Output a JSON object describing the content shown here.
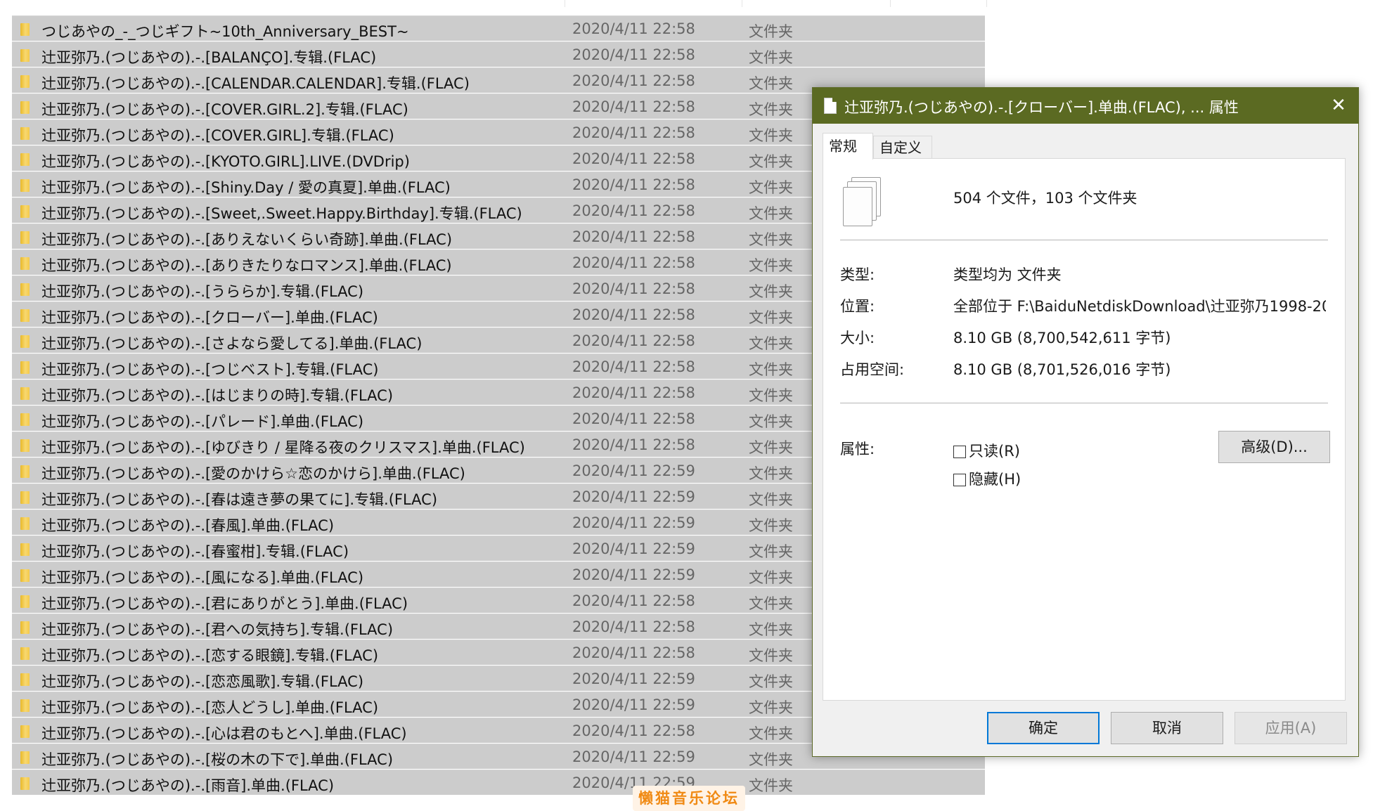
{
  "explorer": {
    "rows": [
      {
        "name": "つじあやの_-_つじギフト~10th_Anniversary_BEST~",
        "date": "2020/4/11 22:58",
        "type": "文件夹"
      },
      {
        "name": "辻亚弥乃.(つじあやの).-.[BALANÇO].专辑.(FLAC)",
        "date": "2020/4/11 22:58",
        "type": "文件夹"
      },
      {
        "name": "辻亚弥乃.(つじあやの).-.[CALENDAR.CALENDAR].专辑.(FLAC)",
        "date": "2020/4/11 22:58",
        "type": "文件夹"
      },
      {
        "name": "辻亚弥乃.(つじあやの).-.[COVER.GIRL.2].专辑.(FLAC)",
        "date": "2020/4/11 22:58",
        "type": "文件夹"
      },
      {
        "name": "辻亚弥乃.(つじあやの).-.[COVER.GIRL].专辑.(FLAC)",
        "date": "2020/4/11 22:58",
        "type": "文件夹"
      },
      {
        "name": "辻亚弥乃.(つじあやの).-.[KYOTO.GIRL].LIVE.(DVDrip)",
        "date": "2020/4/11 22:58",
        "type": "文件夹"
      },
      {
        "name": "辻亚弥乃.(つじあやの).-.[Shiny.Day / 愛の真夏].单曲.(FLAC)",
        "date": "2020/4/11 22:58",
        "type": "文件夹"
      },
      {
        "name": "辻亚弥乃.(つじあやの).-.[Sweet,.Sweet.Happy.Birthday].专辑.(FLAC)",
        "date": "2020/4/11 22:58",
        "type": "文件夹"
      },
      {
        "name": "辻亚弥乃.(つじあやの).-.[ありえないくらい奇跡].单曲.(FLAC)",
        "date": "2020/4/11 22:58",
        "type": "文件夹"
      },
      {
        "name": "辻亚弥乃.(つじあやの).-.[ありきたりなロマンス].单曲.(FLAC)",
        "date": "2020/4/11 22:58",
        "type": "文件夹"
      },
      {
        "name": "辻亚弥乃.(つじあやの).-.[うららか].专辑.(FLAC)",
        "date": "2020/4/11 22:58",
        "type": "文件夹"
      },
      {
        "name": "辻亚弥乃.(つじあやの).-.[クローバー].单曲.(FLAC)",
        "date": "2020/4/11 22:58",
        "type": "文件夹"
      },
      {
        "name": "辻亚弥乃.(つじあやの).-.[さよなら愛してる].单曲.(FLAC)",
        "date": "2020/4/11 22:58",
        "type": "文件夹"
      },
      {
        "name": "辻亚弥乃.(つじあやの).-.[つじベスト].专辑.(FLAC)",
        "date": "2020/4/11 22:58",
        "type": "文件夹"
      },
      {
        "name": "辻亚弥乃.(つじあやの).-.[はじまりの時].专辑.(FLAC)",
        "date": "2020/4/11 22:58",
        "type": "文件夹"
      },
      {
        "name": "辻亚弥乃.(つじあやの).-.[パレード].单曲.(FLAC)",
        "date": "2020/4/11 22:58",
        "type": "文件夹"
      },
      {
        "name": "辻亚弥乃.(つじあやの).-.[ゆびきり / 星降る夜のクリスマス].单曲.(FLAC)",
        "date": "2020/4/11 22:58",
        "type": "文件夹"
      },
      {
        "name": "辻亚弥乃.(つじあやの).-.[愛のかけら☆恋のかけら].单曲.(FLAC)",
        "date": "2020/4/11 22:59",
        "type": "文件夹"
      },
      {
        "name": "辻亚弥乃.(つじあやの).-.[春は遠き夢の果てに].专辑.(FLAC)",
        "date": "2020/4/11 22:59",
        "type": "文件夹"
      },
      {
        "name": "辻亚弥乃.(つじあやの).-.[春風].单曲.(FLAC)",
        "date": "2020/4/11 22:59",
        "type": "文件夹"
      },
      {
        "name": "辻亚弥乃.(つじあやの).-.[春蜜柑].专辑.(FLAC)",
        "date": "2020/4/11 22:59",
        "type": "文件夹"
      },
      {
        "name": "辻亚弥乃.(つじあやの).-.[風になる].单曲.(FLAC)",
        "date": "2020/4/11 22:59",
        "type": "文件夹"
      },
      {
        "name": "辻亚弥乃.(つじあやの).-.[君にありがとう].单曲.(FLAC)",
        "date": "2020/4/11 22:58",
        "type": "文件夹"
      },
      {
        "name": "辻亚弥乃.(つじあやの).-.[君への気持ち].专辑.(FLAC)",
        "date": "2020/4/11 22:58",
        "type": "文件夹"
      },
      {
        "name": "辻亚弥乃.(つじあやの).-.[恋する眼鏡].专辑.(FLAC)",
        "date": "2020/4/11 22:58",
        "type": "文件夹"
      },
      {
        "name": "辻亚弥乃.(つじあやの).-.[恋恋風歌].专辑.(FLAC)",
        "date": "2020/4/11 22:59",
        "type": "文件夹"
      },
      {
        "name": "辻亚弥乃.(つじあやの).-.[恋人どうし].单曲.(FLAC)",
        "date": "2020/4/11 22:59",
        "type": "文件夹"
      },
      {
        "name": "辻亚弥乃.(つじあやの).-.[心は君のもとへ].单曲.(FLAC)",
        "date": "2020/4/11 22:58",
        "type": "文件夹"
      },
      {
        "name": "辻亚弥乃.(つじあやの).-.[桜の木の下で].单曲.(FLAC)",
        "date": "2020/4/11 22:59",
        "type": "文件夹"
      },
      {
        "name": "辻亚弥乃.(つじあやの).-.[雨音].单曲.(FLAC)",
        "date": "2020/4/11 22:59",
        "type": "文件夹"
      }
    ]
  },
  "dialog": {
    "title": "辻亚弥乃.(つじあやの).-.[クローバー].单曲.(FLAC), ... 属性",
    "close_glyph": "✕",
    "tabs": [
      "常规",
      "自定义"
    ],
    "summary": "504 个文件，103 个文件夹",
    "type_label": "类型:",
    "type_value": "类型均为 文件夹",
    "location_label": "位置:",
    "location_value": "全部位于 F:\\BaiduNetdiskDownload\\辻亚弥乃1998-20(",
    "size_label": "大小:",
    "size_value": "8.10 GB (8,700,542,611 字节)",
    "size_on_disk_label": "占用空间:",
    "size_on_disk_value": "8.10 GB (8,701,526,016 字节)",
    "attributes_label": "属性:",
    "readonly_label": "只读(R)",
    "hidden_label": "隐藏(H)",
    "advanced_label": "高级(D)...",
    "ok_label": "确定",
    "cancel_label": "取消",
    "apply_label": "应用(A)",
    "title_bar_color": "#5b6a22"
  },
  "watermark": "懒猫音乐论坛"
}
